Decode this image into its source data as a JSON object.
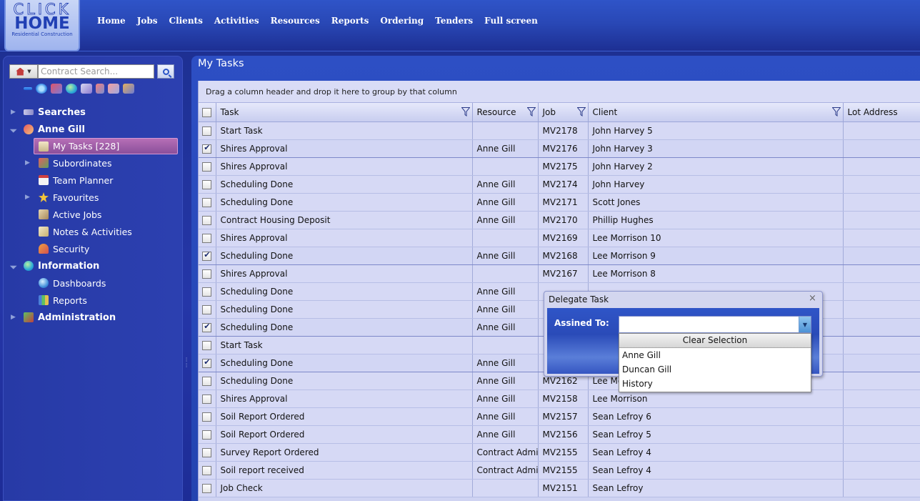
{
  "logo": {
    "line1": "CLICK",
    "line2": "HOME",
    "tagline": "Residential Construction"
  },
  "nav": [
    "Home",
    "Jobs",
    "Clients",
    "Activities",
    "Resources",
    "Reports",
    "Ordering",
    "Tenders",
    "Full screen"
  ],
  "sidebar": {
    "search_placeholder": "Contract Search...",
    "tree": [
      {
        "label": "Searches",
        "level": 0,
        "icon": "binoculars-icon"
      },
      {
        "label": "Anne Gill",
        "level": 0,
        "icon": "user-icon",
        "expanded": true
      },
      {
        "label": "My Tasks [228]",
        "level": 1,
        "icon": "clipboard-icon",
        "selected": true
      },
      {
        "label": "Subordinates",
        "level": 1,
        "icon": "group-icon"
      },
      {
        "label": "Team Planner",
        "level": 1,
        "icon": "calendar-icon"
      },
      {
        "label": "Favourites",
        "level": 1,
        "icon": "star-icon"
      },
      {
        "label": "Active Jobs",
        "level": 1,
        "icon": "box-icon"
      },
      {
        "label": "Notes & Activities",
        "level": 1,
        "icon": "notes-icon"
      },
      {
        "label": "Security",
        "level": 1,
        "icon": "security-icon"
      },
      {
        "label": "Information",
        "level": 0,
        "icon": "globe-icon",
        "expanded": true
      },
      {
        "label": "Dashboards",
        "level": 1,
        "icon": "dashboard-icon"
      },
      {
        "label": "Reports",
        "level": 1,
        "icon": "report-icon"
      },
      {
        "label": "Administration",
        "level": 0,
        "icon": "admin-icon"
      }
    ]
  },
  "main": {
    "title": "My Tasks",
    "group_hint": "Drag a column header and drop it here to group by that column",
    "columns": [
      "Task",
      "Resource",
      "Job",
      "Client",
      "Lot Address"
    ],
    "rows": [
      {
        "checked": false,
        "task": "Start Task",
        "resource": "",
        "job": "MV2178",
        "client": "John Harvey 5"
      },
      {
        "checked": true,
        "task": "Shires Approval",
        "resource": "Anne Gill",
        "job": "MV2176",
        "client": "John Harvey 3"
      },
      {
        "checked": false,
        "task": "Shires Approval",
        "resource": "",
        "job": "MV2175",
        "client": "John Harvey 2"
      },
      {
        "checked": false,
        "task": "Scheduling Done",
        "resource": "Anne Gill",
        "job": "MV2174",
        "client": "John Harvey"
      },
      {
        "checked": false,
        "task": "Scheduling Done",
        "resource": "Anne Gill",
        "job": "MV2171",
        "client": "Scott Jones"
      },
      {
        "checked": false,
        "task": "Contract Housing Deposit",
        "resource": "Anne Gill",
        "job": "MV2170",
        "client": "Phillip Hughes"
      },
      {
        "checked": false,
        "task": "Shires Approval",
        "resource": "",
        "job": "MV2169",
        "client": "Lee Morrison 10"
      },
      {
        "checked": true,
        "task": "Scheduling Done",
        "resource": "Anne Gill",
        "job": "MV2168",
        "client": "Lee Morrison 9"
      },
      {
        "checked": false,
        "task": "Shires Approval",
        "resource": "",
        "job": "MV2167",
        "client": "Lee Morrison 8"
      },
      {
        "checked": false,
        "task": "Scheduling Done",
        "resource": "Anne Gill",
        "job": "",
        "client": ""
      },
      {
        "checked": false,
        "task": "Scheduling Done",
        "resource": "Anne Gill",
        "job": "",
        "client": ""
      },
      {
        "checked": true,
        "task": "Scheduling Done",
        "resource": "Anne Gill",
        "job": "",
        "client": ""
      },
      {
        "checked": false,
        "task": "Start Task",
        "resource": "",
        "job": "",
        "client": ""
      },
      {
        "checked": true,
        "task": "Scheduling Done",
        "resource": "Anne Gill",
        "job": "",
        "client": ""
      },
      {
        "checked": false,
        "task": "Scheduling Done",
        "resource": "Anne Gill",
        "job": "MV2162",
        "client": "Lee Mo"
      },
      {
        "checked": false,
        "task": "Shires Approval",
        "resource": "Anne Gill",
        "job": "MV2158",
        "client": "Lee Morrison"
      },
      {
        "checked": false,
        "task": "Soil Report Ordered",
        "resource": "Anne Gill",
        "job": "MV2157",
        "client": "Sean Lefroy 6"
      },
      {
        "checked": false,
        "task": "Soil Report Ordered",
        "resource": "Anne Gill",
        "job": "MV2156",
        "client": "Sean Lefroy 5"
      },
      {
        "checked": false,
        "task": "Survey Report Ordered",
        "resource": "Contract Admin",
        "job": "MV2155",
        "client": "Sean Lefroy 4"
      },
      {
        "checked": false,
        "task": "Soil report received",
        "resource": "Contract Admin",
        "job": "MV2155",
        "client": "Sean Lefroy 4"
      },
      {
        "checked": false,
        "task": "Job Check",
        "resource": "",
        "job": "MV2151",
        "client": "Sean Lefroy"
      }
    ]
  },
  "dialog": {
    "title": "Delegate Task",
    "label": "Assined To:",
    "value": "",
    "clear_label": "Clear Selection",
    "options": [
      "Anne Gill",
      "Duncan Gill",
      "History"
    ]
  }
}
